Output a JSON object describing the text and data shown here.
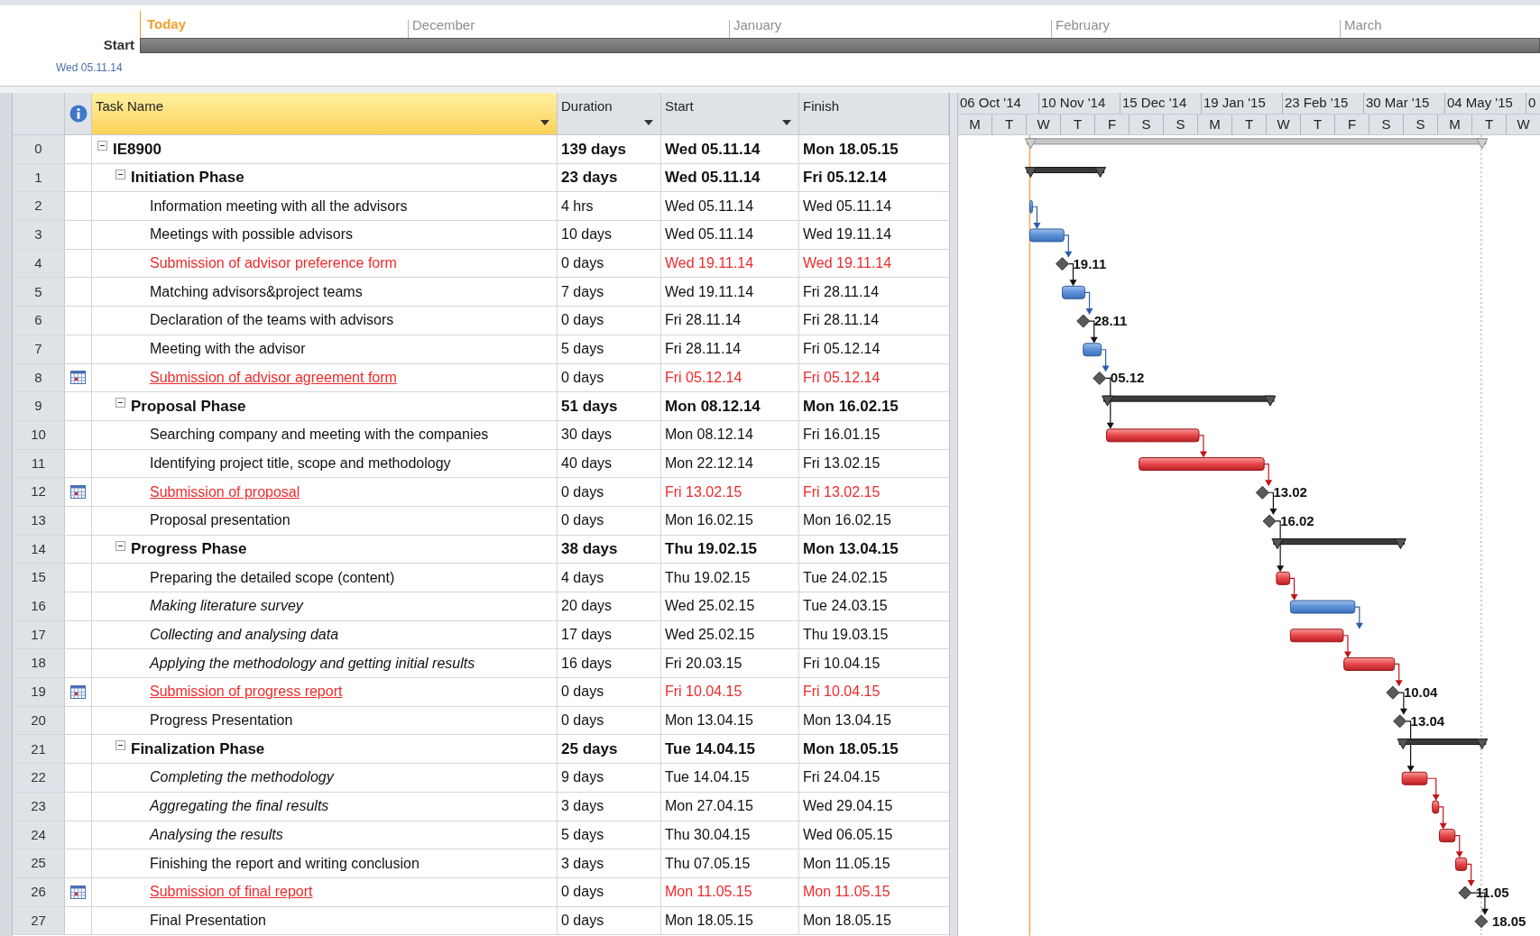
{
  "timeline": {
    "today_label": "Today",
    "months": [
      "December",
      "January",
      "February",
      "March"
    ],
    "start_label": "Start",
    "start_date": "Wed 05.11.14"
  },
  "columns": [
    {
      "label": "Task Name",
      "filter": true,
      "selected": true
    },
    {
      "label": "Duration",
      "filter": true,
      "selected": false
    },
    {
      "label": "Start",
      "filter": true,
      "selected": false
    },
    {
      "label": "Finish",
      "filter": false,
      "selected": false
    }
  ],
  "timescale": {
    "weeks": [
      "06 Oct '14",
      "10 Nov '14",
      "15 Dec '14",
      "19 Jan '15",
      "23 Feb '15",
      "30 Mar '15",
      "04 May '15",
      "0"
    ],
    "days": [
      "M",
      "T",
      "W",
      "T",
      "F",
      "S",
      "S",
      "M",
      "T",
      "W",
      "T",
      "F",
      "S",
      "S",
      "M",
      "T",
      "W"
    ]
  },
  "tasks": [
    {
      "row": "0",
      "name": "IE8900",
      "duration": "139 days",
      "start": "Wed 05.11.14",
      "finish": "Mon 18.05.15",
      "kind": "project",
      "expanded": true,
      "highlighted": false,
      "italic": false,
      "underlined": false,
      "indicator": false,
      "children": [
        {
          "row": "1",
          "name": "Initiation Phase",
          "duration": "23 days",
          "start": "Wed 05.11.14",
          "finish": "Fri 05.12.14",
          "kind": "summary",
          "expanded": true,
          "highlighted": false,
          "italic": false,
          "underlined": false,
          "indicator": false,
          "children": [
            {
              "row": "2",
              "name": "Information meeting with all the advisors",
              "duration": "4 hrs",
              "start": "Wed 05.11.14",
              "finish": "Wed 05.11.14",
              "kind": "task",
              "critical": false,
              "highlighted": false,
              "italic": false,
              "underlined": false,
              "indicator": false
            },
            {
              "row": "3",
              "name": "Meetings with possible advisors",
              "duration": "10 days",
              "start": "Wed 05.11.14",
              "finish": "Wed 19.11.14",
              "kind": "task",
              "critical": false,
              "highlighted": false,
              "italic": false,
              "underlined": false,
              "indicator": false
            },
            {
              "row": "4",
              "name": "Submission of advisor preference form",
              "duration": "0 days",
              "start": "Wed 19.11.14",
              "finish": "Wed 19.11.14",
              "kind": "milestone",
              "label": "19.11",
              "highlighted": true,
              "italic": false,
              "underlined": false,
              "indicator": false
            },
            {
              "row": "5",
              "name": "Matching advisors&project teams",
              "duration": "7 days",
              "start": "Wed 19.11.14",
              "finish": "Fri 28.11.14",
              "kind": "task",
              "critical": false,
              "highlighted": false,
              "italic": false,
              "underlined": false,
              "indicator": false
            },
            {
              "row": "6",
              "name": "Declaration of the teams with advisors",
              "duration": "0 days",
              "start": "Fri 28.11.14",
              "finish": "Fri 28.11.14",
              "kind": "milestone",
              "label": "28.11",
              "highlighted": false,
              "italic": false,
              "underlined": false,
              "indicator": false
            },
            {
              "row": "7",
              "name": "Meeting with the advisor",
              "duration": "5 days",
              "start": "Fri 28.11.14",
              "finish": "Fri 05.12.14",
              "kind": "task",
              "critical": false,
              "highlighted": false,
              "italic": false,
              "underlined": false,
              "indicator": false
            },
            {
              "row": "8",
              "name": "Submission of advisor agreement form",
              "duration": "0 days",
              "start": "Fri 05.12.14",
              "finish": "Fri 05.12.14",
              "kind": "milestone",
              "label": "05.12",
              "highlighted": true,
              "italic": false,
              "underlined": true,
              "indicator": true
            }
          ]
        },
        {
          "row": "9",
          "name": "Proposal Phase",
          "duration": "51 days",
          "start": "Mon 08.12.14",
          "finish": "Mon 16.02.15",
          "kind": "summary",
          "expanded": true,
          "highlighted": false,
          "italic": false,
          "underlined": false,
          "indicator": false,
          "children": [
            {
              "row": "10",
              "name": "Searching company and meeting with the companies",
              "duration": "30 days",
              "start": "Mon 08.12.14",
              "finish": "Fri 16.01.15",
              "kind": "task",
              "critical": true,
              "highlighted": false,
              "italic": false,
              "underlined": false,
              "indicator": false
            },
            {
              "row": "11",
              "name": "Identifying project title, scope and methodology",
              "duration": "40 days",
              "start": "Mon 22.12.14",
              "finish": "Fri 13.02.15",
              "kind": "task",
              "critical": true,
              "highlighted": false,
              "italic": false,
              "underlined": false,
              "indicator": false
            },
            {
              "row": "12",
              "name": "Submission of proposal",
              "duration": "0 days",
              "start": "Fri 13.02.15",
              "finish": "Fri 13.02.15",
              "kind": "milestone",
              "label": "13.02",
              "highlighted": true,
              "italic": false,
              "underlined": true,
              "indicator": true
            },
            {
              "row": "13",
              "name": "Proposal presentation",
              "duration": "0 days",
              "start": "Mon 16.02.15",
              "finish": "Mon 16.02.15",
              "kind": "milestone",
              "label": "16.02",
              "highlighted": false,
              "italic": false,
              "underlined": false,
              "indicator": false
            }
          ]
        },
        {
          "row": "14",
          "name": "Progress Phase",
          "duration": "38 days",
          "start": "Thu 19.02.15",
          "finish": "Mon 13.04.15",
          "kind": "summary",
          "expanded": true,
          "highlighted": false,
          "italic": false,
          "underlined": false,
          "indicator": false,
          "children": [
            {
              "row": "15",
              "name": "Preparing the detailed scope (content)",
              "duration": "4 days",
              "start": "Thu 19.02.15",
              "finish": "Tue 24.02.15",
              "kind": "task",
              "critical": true,
              "highlighted": false,
              "italic": false,
              "underlined": false,
              "indicator": false
            },
            {
              "row": "16",
              "name": "Making literature survey",
              "duration": "20 days",
              "start": "Wed 25.02.15",
              "finish": "Tue 24.03.15",
              "kind": "task",
              "critical": false,
              "highlighted": false,
              "italic": true,
              "underlined": false,
              "indicator": false
            },
            {
              "row": "17",
              "name": "Collecting and analysing data",
              "duration": "17 days",
              "start": "Wed 25.02.15",
              "finish": "Thu 19.03.15",
              "kind": "task",
              "critical": true,
              "highlighted": false,
              "italic": true,
              "underlined": false,
              "indicator": false
            },
            {
              "row": "18",
              "name": "Applying the methodology and getting initial results",
              "duration": "16 days",
              "start": "Fri 20.03.15",
              "finish": "Fri 10.04.15",
              "kind": "task",
              "critical": true,
              "highlighted": false,
              "italic": true,
              "underlined": false,
              "indicator": false
            },
            {
              "row": "19",
              "name": "Submission of progress report",
              "duration": "0 days",
              "start": "Fri 10.04.15",
              "finish": "Fri 10.04.15",
              "kind": "milestone",
              "label": "10.04",
              "highlighted": true,
              "italic": false,
              "underlined": true,
              "indicator": true
            },
            {
              "row": "20",
              "name": "Progress Presentation",
              "duration": "0 days",
              "start": "Mon 13.04.15",
              "finish": "Mon 13.04.15",
              "kind": "milestone",
              "label": "13.04",
              "highlighted": false,
              "italic": false,
              "underlined": false,
              "indicator": false
            }
          ]
        },
        {
          "row": "21",
          "name": "Finalization Phase",
          "duration": "25 days",
          "start": "Tue 14.04.15",
          "finish": "Mon 18.05.15",
          "kind": "summary",
          "expanded": true,
          "highlighted": false,
          "italic": false,
          "underlined": false,
          "indicator": false,
          "children": [
            {
              "row": "22",
              "name": "Completing the methodology",
              "duration": "9 days",
              "start": "Tue 14.04.15",
              "finish": "Fri 24.04.15",
              "kind": "task",
              "critical": true,
              "highlighted": false,
              "italic": true,
              "underlined": false,
              "indicator": false
            },
            {
              "row": "23",
              "name": "Aggregating the final results",
              "duration": "3 days",
              "start": "Mon 27.04.15",
              "finish": "Wed 29.04.15",
              "kind": "task",
              "critical": true,
              "highlighted": false,
              "italic": true,
              "underlined": false,
              "indicator": false
            },
            {
              "row": "24",
              "name": "Analysing the results",
              "duration": "5 days",
              "start": "Thu 30.04.15",
              "finish": "Wed 06.05.15",
              "kind": "task",
              "critical": true,
              "highlighted": false,
              "italic": true,
              "underlined": false,
              "indicator": false
            },
            {
              "row": "25",
              "name": "Finishing the report and writing conclusion",
              "duration": "3 days",
              "start": "Thu 07.05.15",
              "finish": "Mon 11.05.15",
              "kind": "task",
              "critical": true,
              "highlighted": false,
              "italic": false,
              "underlined": false,
              "indicator": false
            },
            {
              "row": "26",
              "name": "Submission of final report",
              "duration": "0 days",
              "start": "Mon 11.05.15",
              "finish": "Mon 11.05.15",
              "kind": "milestone",
              "label": "11.05",
              "highlighted": true,
              "italic": false,
              "underlined": true,
              "indicator": true
            },
            {
              "row": "27",
              "name": "Final Presentation",
              "duration": "0 days",
              "start": "Mon 18.05.15",
              "finish": "Mon 18.05.15",
              "kind": "milestone",
              "label": "18.05",
              "highlighted": false,
              "italic": false,
              "underlined": false,
              "indicator": false
            }
          ]
        }
      ]
    }
  ]
}
